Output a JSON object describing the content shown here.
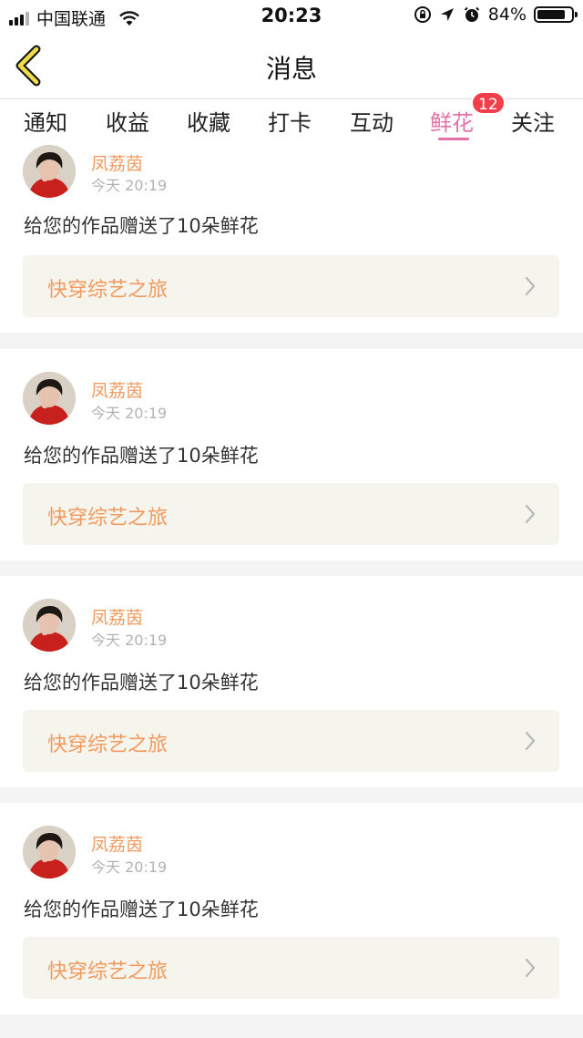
{
  "status_bar": {
    "carrier": "中国联通",
    "time": "20:23",
    "battery_text": "84%",
    "battery_level": 0.84
  },
  "nav": {
    "title": "消息"
  },
  "tabs": [
    {
      "label": "通知"
    },
    {
      "label": "收益"
    },
    {
      "label": "收藏"
    },
    {
      "label": "打卡"
    },
    {
      "label": "互动"
    },
    {
      "label": "鲜花",
      "active": true
    },
    {
      "label": "关注"
    }
  ],
  "badge": "12",
  "colors": {
    "accent_pink": "#e56fa7",
    "sender_orange": "#f09a5e",
    "badge_red": "#f23d4a"
  },
  "messages": [
    {
      "sender": "凤荔茵",
      "time": "今天 20:19",
      "text": "给您的作品赠送了10朵鲜花",
      "work": "快穿综艺之旅"
    },
    {
      "sender": "凤荔茵",
      "time": "今天 20:19",
      "text": "给您的作品赠送了10朵鲜花",
      "work": "快穿综艺之旅"
    },
    {
      "sender": "凤荔茵",
      "time": "今天 20:19",
      "text": "给您的作品赠送了10朵鲜花",
      "work": "快穿综艺之旅"
    },
    {
      "sender": "凤荔茵",
      "time": "今天 20:19",
      "text": "给您的作品赠送了10朵鲜花",
      "work": "快穿综艺之旅"
    }
  ]
}
